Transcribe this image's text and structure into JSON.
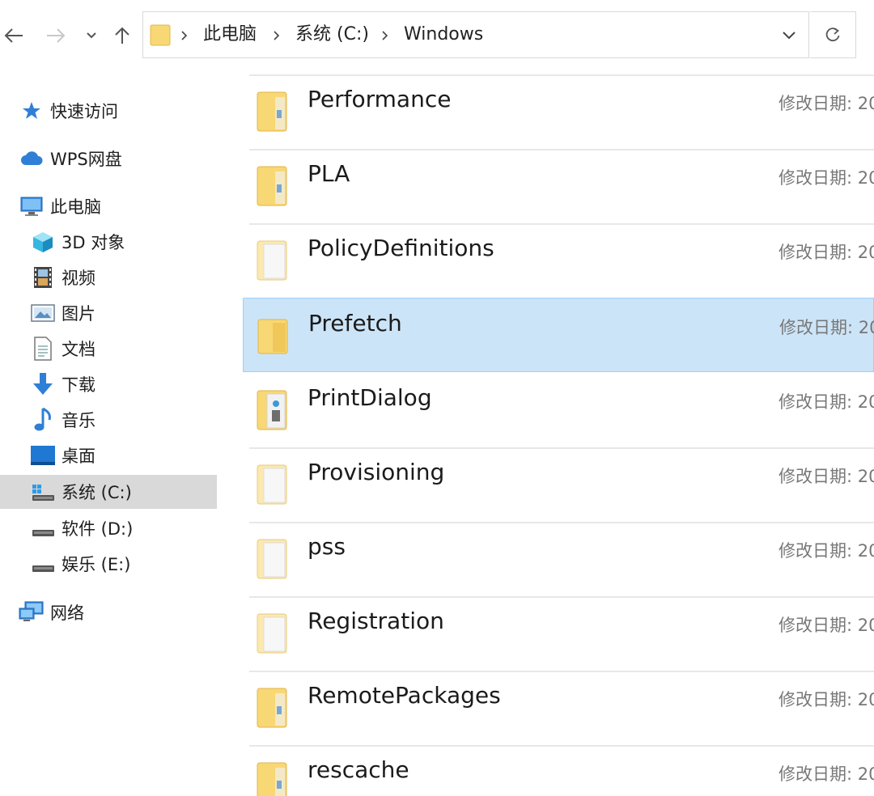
{
  "address_bar": {
    "breadcrumbs": [
      "此电脑",
      "系统 (C:)",
      "Windows"
    ]
  },
  "sidebar": {
    "items": [
      {
        "label": "快速访问",
        "icon": "star-icon"
      },
      {
        "label": "WPS网盘",
        "icon": "cloud-icon"
      },
      {
        "label": "此电脑",
        "icon": "computer-icon"
      },
      {
        "label": "3D 对象",
        "icon": "3d-objects-icon"
      },
      {
        "label": "视频",
        "icon": "video-icon"
      },
      {
        "label": "图片",
        "icon": "picture-icon"
      },
      {
        "label": "文档",
        "icon": "document-icon"
      },
      {
        "label": "下载",
        "icon": "download-icon"
      },
      {
        "label": "音乐",
        "icon": "music-icon"
      },
      {
        "label": "桌面",
        "icon": "desktop-icon"
      },
      {
        "label": "系统 (C:)",
        "icon": "system-drive-icon",
        "selected": true
      },
      {
        "label": "软件 (D:)",
        "icon": "drive-icon"
      },
      {
        "label": "娱乐 (E:)",
        "icon": "drive-icon"
      },
      {
        "label": "网络",
        "icon": "network-icon"
      }
    ]
  },
  "files": [
    {
      "name": "Performance",
      "meta": "修改日期: 20",
      "icon": "folder-icon"
    },
    {
      "name": "PLA",
      "meta": "修改日期: 20",
      "icon": "folder-icon"
    },
    {
      "name": "PolicyDefinitions",
      "meta": "修改日期: 20",
      "icon": "folder-icon"
    },
    {
      "name": "Prefetch",
      "meta": "修改日期: 20",
      "icon": "folder-icon",
      "selected": true
    },
    {
      "name": "PrintDialog",
      "meta": "修改日期: 20",
      "icon": "folder-icon"
    },
    {
      "name": "Provisioning",
      "meta": "修改日期: 20",
      "icon": "folder-icon"
    },
    {
      "name": "pss",
      "meta": "修改日期: 20",
      "icon": "folder-icon"
    },
    {
      "name": "Registration",
      "meta": "修改日期: 20",
      "icon": "folder-icon"
    },
    {
      "name": "RemotePackages",
      "meta": "修改日期: 20",
      "icon": "folder-icon"
    },
    {
      "name": "rescache",
      "meta": "修改日期: 20",
      "icon": "folder-icon"
    }
  ],
  "colors": {
    "selection_bg": "#cce4f7",
    "selection_border": "#99d1ff",
    "sidebar_selected_bg": "#d9d9d9",
    "folder_yellow": "#f8d775"
  }
}
